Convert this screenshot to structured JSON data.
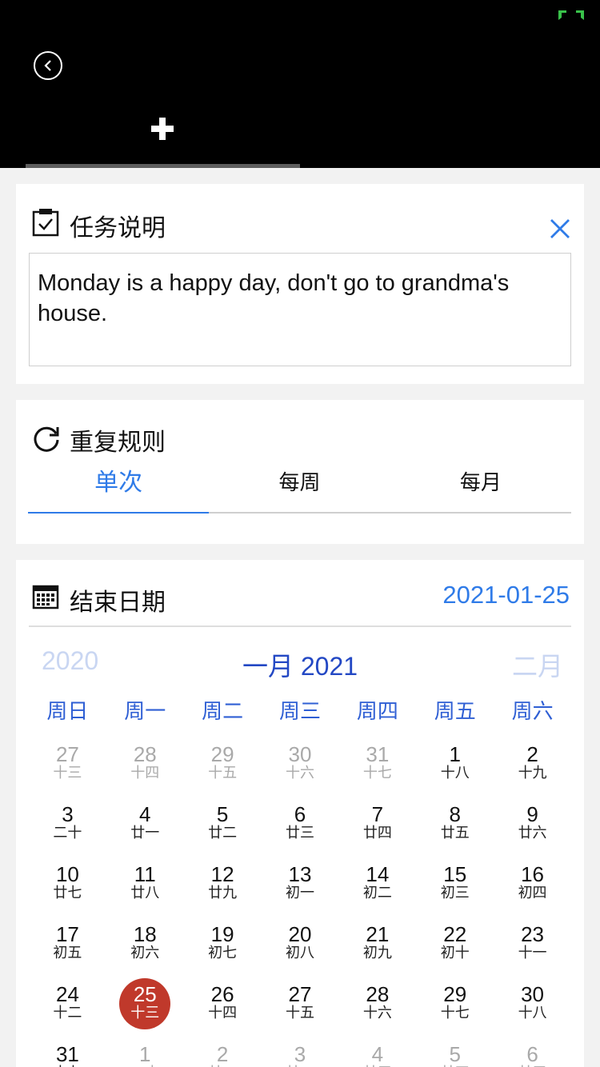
{
  "header": {
    "back_icon": "back-circle-icon",
    "add_icon": "plus-icon",
    "status_icon": "status-indicator-icon"
  },
  "description": {
    "title": "任务说明",
    "icon": "clipboard-check-icon",
    "close_icon": "close-x-icon",
    "text": "Monday is a happy day, don't go to grandma's house."
  },
  "repeat": {
    "title": "重复规则",
    "icon": "refresh-icon",
    "tabs": [
      {
        "label": "单次",
        "active": true
      },
      {
        "label": "每周",
        "active": false
      },
      {
        "label": "每月",
        "active": false
      }
    ]
  },
  "end_date": {
    "title": "结束日期",
    "icon": "calendar-icon",
    "value": "2021-01-25",
    "calendar": {
      "prev": "2020",
      "title": "一月 2021",
      "next": "二月",
      "weekdays": [
        "周日",
        "周一",
        "周二",
        "周三",
        "周四",
        "周五",
        "周六"
      ],
      "days": [
        {
          "n": "27",
          "l": "十三",
          "other": true
        },
        {
          "n": "28",
          "l": "十四",
          "other": true
        },
        {
          "n": "29",
          "l": "十五",
          "other": true
        },
        {
          "n": "30",
          "l": "十六",
          "other": true
        },
        {
          "n": "31",
          "l": "十七",
          "other": true
        },
        {
          "n": "1",
          "l": "十八"
        },
        {
          "n": "2",
          "l": "十九"
        },
        {
          "n": "3",
          "l": "二十"
        },
        {
          "n": "4",
          "l": "廿一"
        },
        {
          "n": "5",
          "l": "廿二"
        },
        {
          "n": "6",
          "l": "廿三"
        },
        {
          "n": "7",
          "l": "廿四"
        },
        {
          "n": "8",
          "l": "廿五"
        },
        {
          "n": "9",
          "l": "廿六"
        },
        {
          "n": "10",
          "l": "廿七"
        },
        {
          "n": "11",
          "l": "廿八"
        },
        {
          "n": "12",
          "l": "廿九"
        },
        {
          "n": "13",
          "l": "初一"
        },
        {
          "n": "14",
          "l": "初二"
        },
        {
          "n": "15",
          "l": "初三"
        },
        {
          "n": "16",
          "l": "初四"
        },
        {
          "n": "17",
          "l": "初五"
        },
        {
          "n": "18",
          "l": "初六"
        },
        {
          "n": "19",
          "l": "初七"
        },
        {
          "n": "20",
          "l": "初八"
        },
        {
          "n": "21",
          "l": "初九"
        },
        {
          "n": "22",
          "l": "初十"
        },
        {
          "n": "23",
          "l": "十一"
        },
        {
          "n": "24",
          "l": "十二"
        },
        {
          "n": "25",
          "l": "十三",
          "selected": true
        },
        {
          "n": "26",
          "l": "十四"
        },
        {
          "n": "27",
          "l": "十五"
        },
        {
          "n": "28",
          "l": "十六"
        },
        {
          "n": "29",
          "l": "十七"
        },
        {
          "n": "30",
          "l": "十八"
        },
        {
          "n": "31",
          "l": "十九"
        },
        {
          "n": "1",
          "l": "二十",
          "other": true
        },
        {
          "n": "2",
          "l": "廿一",
          "other": true
        },
        {
          "n": "3",
          "l": "廿二",
          "other": true
        },
        {
          "n": "4",
          "l": "廿三",
          "other": true
        },
        {
          "n": "5",
          "l": "廿四",
          "other": true
        },
        {
          "n": "6",
          "l": "廿五",
          "other": true
        }
      ]
    }
  },
  "colors": {
    "accent": "#2f7be8",
    "calendar_title": "#2348c4",
    "selected_day": "#c0392b",
    "header_bg": "#000000"
  }
}
